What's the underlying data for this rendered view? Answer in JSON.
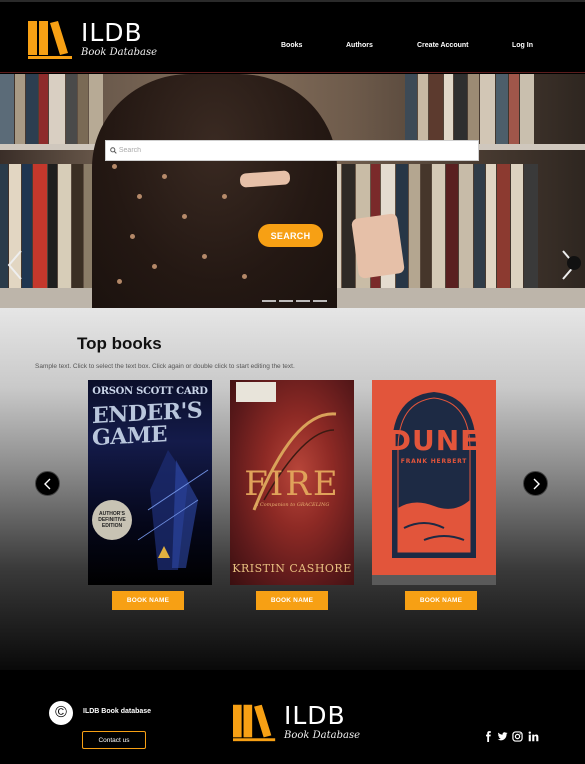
{
  "brand": {
    "name": "ILDB",
    "tagline": "Book Database",
    "accent_color": "#f7a014"
  },
  "nav": {
    "items": [
      {
        "label": "Books"
      },
      {
        "label": "Authors"
      },
      {
        "label": "Create Account"
      },
      {
        "label": "Log In"
      }
    ]
  },
  "hero": {
    "search_placeholder": "Search",
    "search_button": "SEARCH",
    "prev_icon": "chevron-left-icon",
    "next_icon": "chevron-right-icon"
  },
  "top_books": {
    "title": "Top books",
    "description": "Sample text. Click to select the text box. Click again or double click to start editing the text.",
    "books": [
      {
        "author": "ORSON SCOTT CARD",
        "title": "ENDER'S GAME",
        "badge": "AUTHOR'S DEFINITIVE EDITION",
        "button": "BOOK NAME"
      },
      {
        "author": "KRISTIN CASHORE",
        "title": "FIRE",
        "subtitle": "A Companion to GRACELING",
        "button": "BOOK NAME"
      },
      {
        "author": "FRANK HERBERT",
        "title": "DUNE",
        "button": "BOOK NAME"
      }
    ]
  },
  "footer": {
    "copyright_icon": "copyright-icon",
    "text": "ILDB Book database",
    "contact_button": "Contact us",
    "social": [
      "facebook-icon",
      "twitter-icon",
      "instagram-icon",
      "linkedin-icon"
    ]
  }
}
